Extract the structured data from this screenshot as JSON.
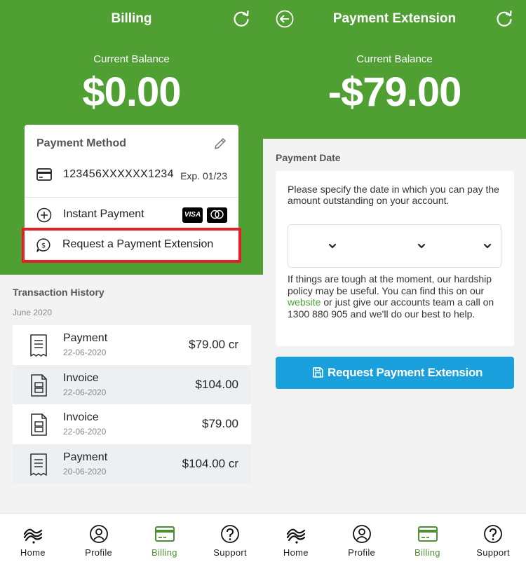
{
  "left_screen": {
    "title": "Billing",
    "balance_label": "Current Balance",
    "balance_amount": "$0.00",
    "payment_method": {
      "title": "Payment Method",
      "card_number": "123456XXXXXX1234",
      "card_expiry": "Exp. 01/23",
      "instant_payment_label": "Instant Payment",
      "visa_label": "VISA",
      "extension_label": "Request a Payment Extension"
    },
    "transaction_history": {
      "title": "Transaction History",
      "month": "June 2020",
      "rows": [
        {
          "type": "Payment",
          "date": "22-06-2020",
          "amount": "$79.00 cr",
          "icon": "receipt-icon"
        },
        {
          "type": "Invoice",
          "date": "22-06-2020",
          "amount": "$104.00",
          "icon": "invoice-icon"
        },
        {
          "type": "Invoice",
          "date": "22-06-2020",
          "amount": "$79.00",
          "icon": "invoice-icon"
        },
        {
          "type": "Payment",
          "date": "20-06-2020",
          "amount": "$104.00 cr",
          "icon": "receipt-icon"
        }
      ]
    }
  },
  "right_screen": {
    "title": "Payment Extension",
    "balance_label": "Current Balance",
    "balance_amount": "-$79.00",
    "payment_date": {
      "title": "Payment Date",
      "instructions": "Please specify the date in which you can pay the amount outstanding on your account.",
      "hardship_before": "If things are tough at the moment, our hardship policy may be useful. You can find this on our ",
      "hardship_link": "website",
      "hardship_after": " or just give our accounts team a call on 1300 880 905 and we'll do our best to help."
    },
    "request_button_label": "Request Payment Extension"
  },
  "bottom_nav": {
    "items": [
      {
        "label": "Home",
        "icon": "home-swirl-icon"
      },
      {
        "label": "Profile",
        "icon": "profile-icon"
      },
      {
        "label": "Billing",
        "icon": "billing-card-icon",
        "active": true
      },
      {
        "label": "Support",
        "icon": "support-question-icon"
      }
    ]
  },
  "colors": {
    "header_green": "#4f9f33",
    "highlight_red": "#e3202a",
    "button_blue": "#1aa0dc",
    "link_green": "#4f9f33"
  }
}
